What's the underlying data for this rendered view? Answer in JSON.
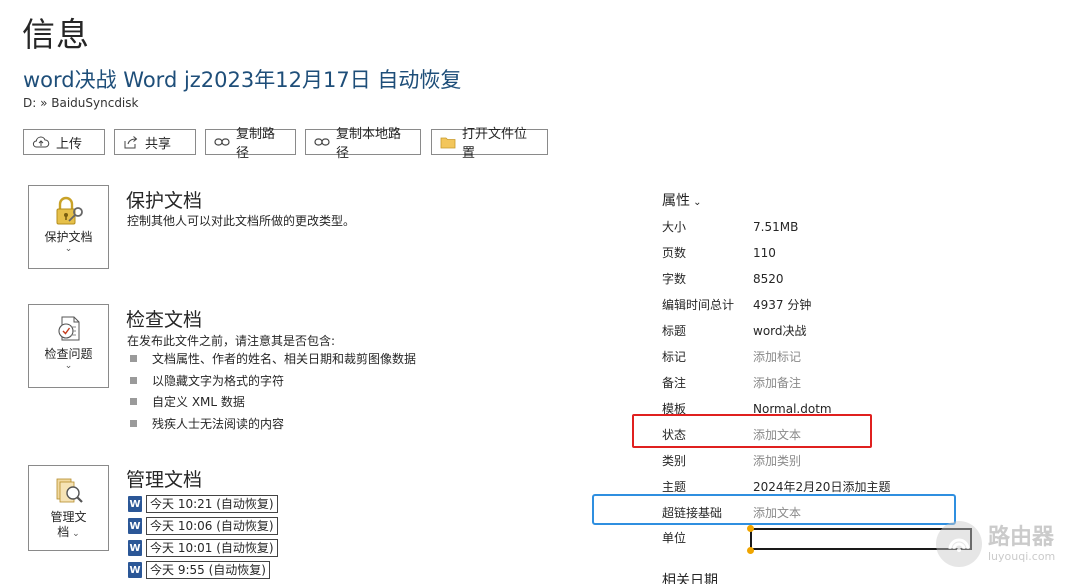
{
  "header": {
    "page_title": "信息",
    "doc_title": "word决战 Word jz2023年12月17日 自动恢复",
    "doc_path": "D: » BaiduSyncdisk"
  },
  "toolbar": {
    "upload": "上传",
    "share": "共享",
    "copy_path": "复制路径",
    "copy_local_path": "复制本地路径",
    "open_location": "打开文件位置"
  },
  "protect": {
    "button_label": "保护文档",
    "title": "保护文档",
    "desc": "控制其他人可以对此文档所做的更改类型。"
  },
  "inspect": {
    "button_label": "检查问题",
    "title": "检查文档",
    "desc": "在发布此文件之前，请注意其是否包含:",
    "items": [
      "文档属性、作者的姓名、相关日期和裁剪图像数据",
      "以隐藏文字为格式的字符",
      "自定义 XML 数据",
      "残疾人士无法阅读的内容"
    ]
  },
  "manage": {
    "button_label_line1": "管理文",
    "button_label_line2": "档",
    "title": "管理文档",
    "versions": [
      "今天 10:21 (自动恢复)",
      "今天 10:06 (自动恢复)",
      "今天 10:01 (自动恢复)",
      "今天 9:55 (自动恢复)"
    ]
  },
  "properties": {
    "heading": "属性",
    "rows": [
      {
        "key": "大小",
        "value": "7.51MB"
      },
      {
        "key": "页数",
        "value": "110"
      },
      {
        "key": "字数",
        "value": "8520"
      },
      {
        "key": "编辑时间总计",
        "value": "4937 分钟"
      },
      {
        "key": "标题",
        "value": "word决战"
      },
      {
        "key": "标记",
        "value": "添加标记"
      },
      {
        "key": "备注",
        "value": "添加备注"
      },
      {
        "key": "模板",
        "value": "Normal.dotm"
      },
      {
        "key": "状态",
        "value": "添加文本"
      },
      {
        "key": "类别",
        "value": "添加类别"
      },
      {
        "key": "主题",
        "value": "2024年2月20日添加主题"
      },
      {
        "key": "超链接基础",
        "value": "添加文本"
      }
    ],
    "unit_label": "单位",
    "related_dates": "相关日期"
  },
  "watermark": {
    "cn": "路由器",
    "en": "luyouqi.com"
  },
  "colors": {
    "title_blue": "#1e4e79",
    "highlight_red": "#e0201f",
    "highlight_blue": "#2f8fe0"
  }
}
